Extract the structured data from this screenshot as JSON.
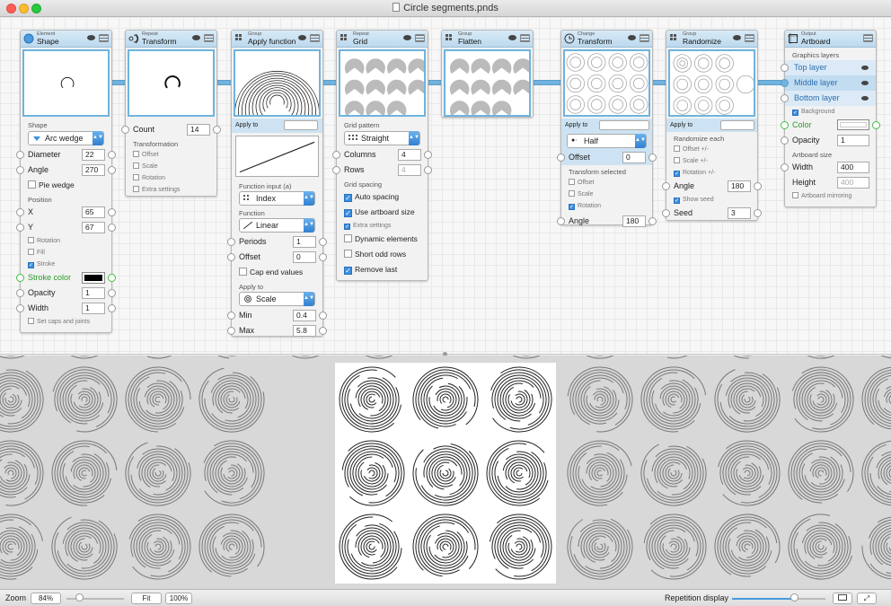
{
  "window": {
    "title": "Circle segments.pnds"
  },
  "nodes": {
    "shape": {
      "category": "Element",
      "name": "Shape",
      "shape_label": "Shape",
      "shape_value": "Arc wedge",
      "diameter_label": "Diameter",
      "diameter": "22",
      "angle_label": "Angle",
      "angle": "270",
      "pie_wedge": "Pie wedge",
      "position_label": "Position",
      "x_label": "X",
      "x": "65",
      "y_label": "Y",
      "y": "67",
      "rotation": "Rotation",
      "fill": "Fill",
      "stroke": "Stroke",
      "stroke_color_label": "Stroke color",
      "opacity_label": "Opacity",
      "opacity": "1",
      "width_label": "Width",
      "width": "1",
      "caps": "Set caps and joints"
    },
    "repeat_transform": {
      "category": "Repeat",
      "name": "Transform",
      "count_label": "Count",
      "count": "14",
      "transformation_label": "Transformation",
      "offset": "Offset",
      "scale": "Scale",
      "rotation": "Rotation",
      "extra": "Extra settings"
    },
    "apply_function": {
      "category": "Group",
      "name": "Apply function",
      "apply_to": "Apply to",
      "function_input_label": "Function input (a)",
      "function_input": "Index",
      "function_label": "Function",
      "function": "Linear",
      "periods_label": "Periods",
      "periods": "1",
      "offset_label": "Offset",
      "offset": "0",
      "cap_end": "Cap end values",
      "apply_to2": "Apply to",
      "apply_target": "Scale",
      "min_label": "Min",
      "min": "0.4",
      "max_label": "Max",
      "max": "5.8"
    },
    "grid": {
      "category": "Repeat",
      "name": "Grid",
      "pattern_label": "Grid pattern",
      "pattern": "Straight",
      "columns_label": "Columns",
      "columns": "4",
      "rows_label": "Rows",
      "rows": "4",
      "spacing_label": "Grid spacing",
      "auto_spacing": "Auto spacing",
      "artboard_size": "Use artboard size",
      "extra": "Extra settings",
      "dynamic": "Dynamic elements",
      "short_odd": "Short odd rows",
      "remove_last": "Remove last"
    },
    "flatten": {
      "category": "Group",
      "name": "Flatten"
    },
    "change_transform": {
      "category": "Change",
      "name": "Transform",
      "apply_to": "Apply to",
      "mode": "Half",
      "offset_label": "Offset",
      "offset": "0",
      "transform_selected": "Transform selected",
      "t_offset": "Offset",
      "t_scale": "Scale",
      "t_rotation": "Rotation",
      "angle_label": "Angle",
      "angle": "180"
    },
    "randomize": {
      "category": "Group",
      "name": "Randomize",
      "apply_to": "Apply to",
      "randomize_each": "Randomize each",
      "offset": "Offset +/-",
      "scale": "Scale +/-",
      "rotation": "Rotation +/-",
      "angle_label": "Angle",
      "angle": "180",
      "show_seed": "Show seed",
      "seed_label": "Seed",
      "seed": "3"
    },
    "artboard": {
      "category": "Output",
      "name": "Artboard",
      "layers_label": "Graphics layers",
      "layers": [
        "Top layer",
        "Middle layer",
        "Bottom layer"
      ],
      "background": "Background",
      "color_label": "Color",
      "opacity_label": "Opacity",
      "opacity": "1",
      "size_label": "Artboard size",
      "width_label": "Width",
      "width": "400",
      "height_label": "Height",
      "height": "400",
      "mirroring": "Artboard mirroring"
    }
  },
  "status": {
    "zoom_label": "Zoom",
    "zoom": "84%",
    "fit": "Fit",
    "hundred": "100%",
    "repetition": "Repetition display"
  },
  "colors": {
    "accent": "#6fb3de",
    "node_header": "#c9e1f2",
    "checkbox": "#3b8fe0",
    "port_green": "#3fbf3f"
  }
}
